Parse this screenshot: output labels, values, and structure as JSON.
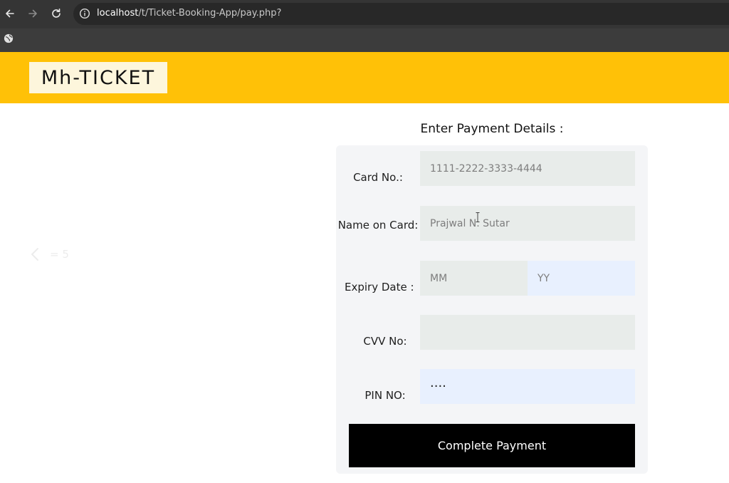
{
  "browser": {
    "url_host": "localhost",
    "url_path": "/t/Ticket-Booking-App/pay.php?"
  },
  "header": {
    "logo_text": "Mh-TICKET"
  },
  "carousel": {
    "counter_text": "= 5"
  },
  "form": {
    "title": "Enter Payment Details :",
    "card_no": {
      "label": "Card No.:",
      "placeholder": "1111-2222-3333-4444",
      "value": ""
    },
    "name_on_card": {
      "label": "Name on Card:",
      "placeholder": "Prajwal N. Sutar",
      "value": ""
    },
    "expiry": {
      "label": "Expiry Date :",
      "month_placeholder": "MM",
      "year_placeholder": "YY"
    },
    "cvv": {
      "label": "CVV No:",
      "placeholder": "",
      "value": ""
    },
    "pin": {
      "label": "PIN NO:",
      "value": "....",
      "type": "password"
    },
    "submit_label": "Complete Payment"
  },
  "colors": {
    "header_bg": "#ffc107",
    "button_bg": "#000000",
    "form_bg": "#f4f5f7",
    "input_bg": "#e8ecea",
    "autofill_bg": "#e8f0fe"
  }
}
